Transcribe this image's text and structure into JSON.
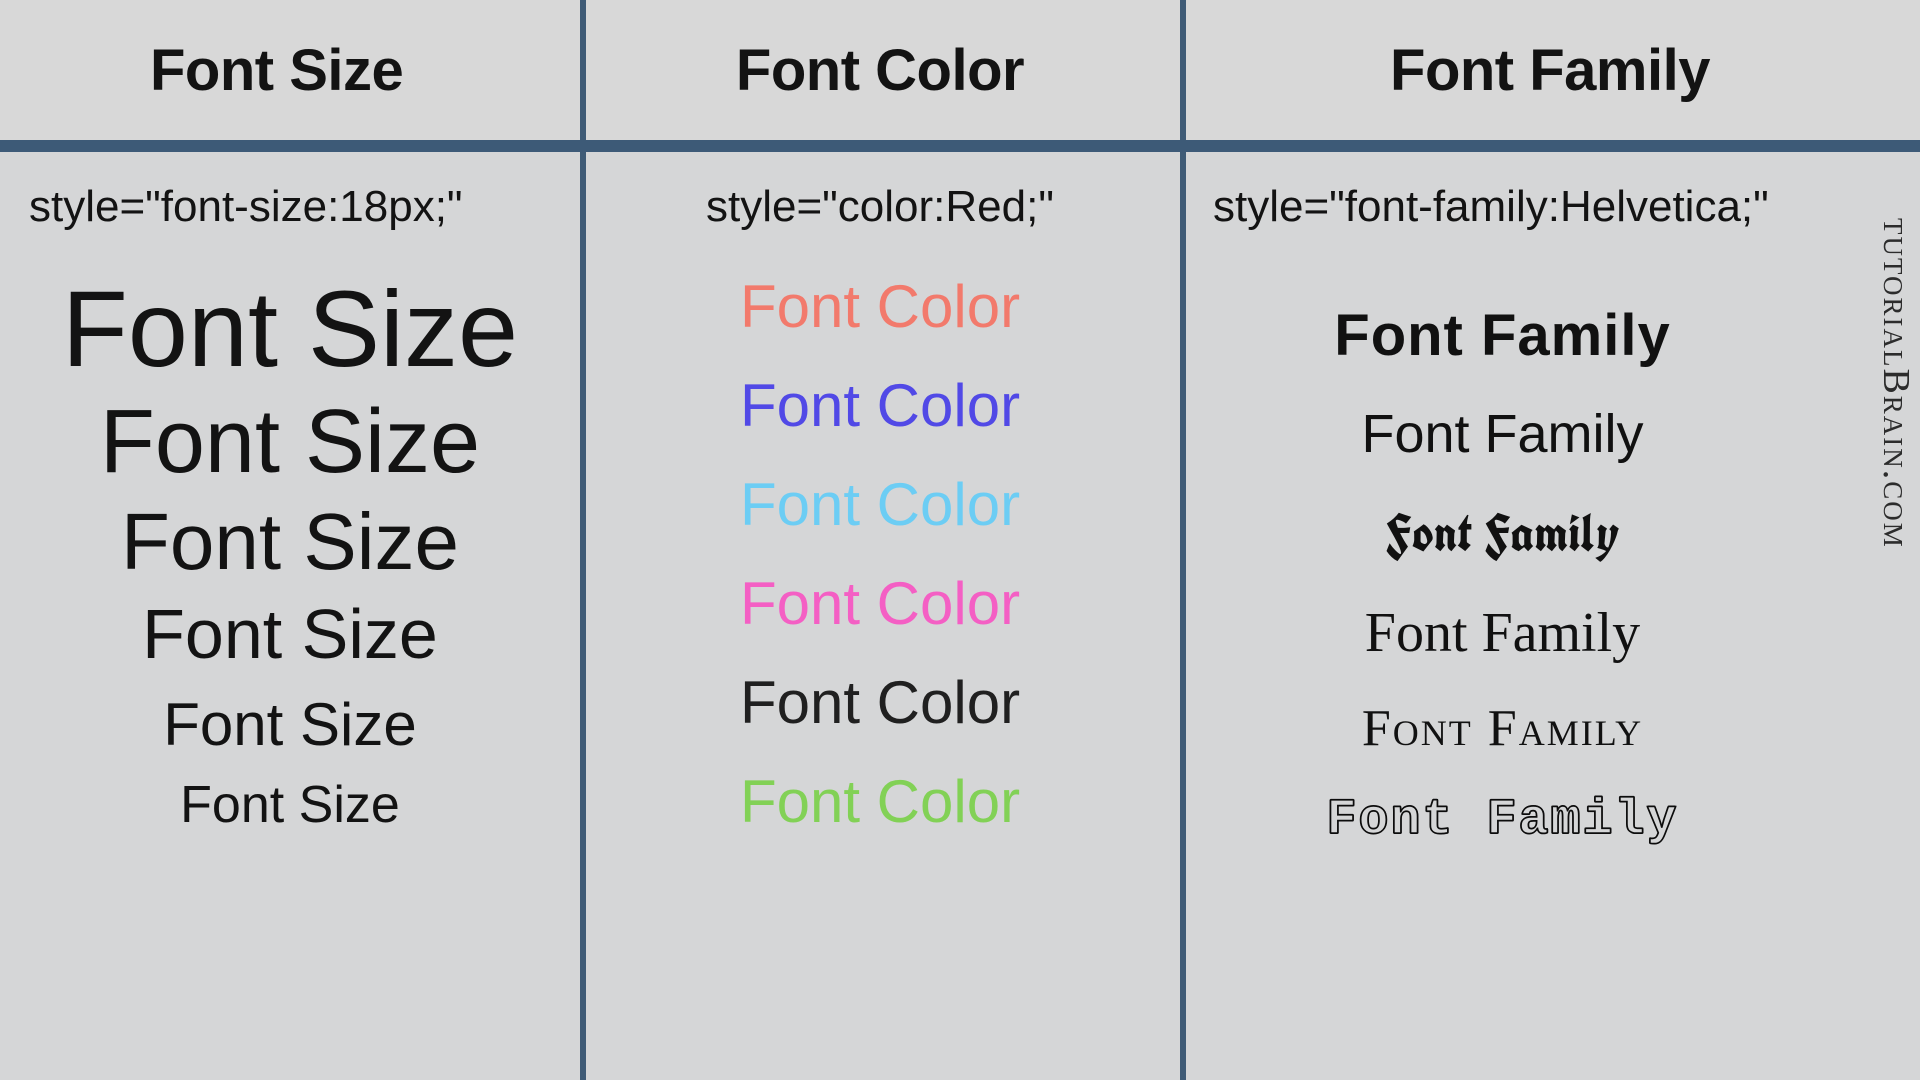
{
  "headers": {
    "size": "Font Size",
    "color": "Font Color",
    "family": "Font Family"
  },
  "syntax": {
    "size": "style=\"font-size:18px;\"",
    "color": "style=\"color:Red;\"",
    "family": "style=\"font-family:Helvetica;\""
  },
  "column_size": {
    "items": [
      {
        "label": "Font Size"
      },
      {
        "label": "Font Size"
      },
      {
        "label": "Font Size"
      },
      {
        "label": "Font Size"
      },
      {
        "label": "Font Size"
      },
      {
        "label": "Font Size"
      }
    ]
  },
  "column_color": {
    "items": [
      {
        "label": "Font Color",
        "color_name": "red",
        "hex": "#f27a6c"
      },
      {
        "label": "Font Color",
        "color_name": "blue",
        "hex": "#5149e6"
      },
      {
        "label": "Font Color",
        "color_name": "cyan",
        "hex": "#6ccdf4"
      },
      {
        "label": "Font Color",
        "color_name": "magenta",
        "hex": "#f45fc4"
      },
      {
        "label": "Font Color",
        "color_name": "black",
        "hex": "#202020"
      },
      {
        "label": "Font Color",
        "color_name": "green",
        "hex": "#82d156"
      }
    ]
  },
  "column_family": {
    "items": [
      {
        "label": "Font Family",
        "style": "display-heavy"
      },
      {
        "label": "Font Family",
        "style": "sans-serif"
      },
      {
        "label": "Font Family",
        "style": "blackletter"
      },
      {
        "label": "Font Family",
        "style": "serif"
      },
      {
        "label": "Font Family",
        "style": "small-caps-serif"
      },
      {
        "label": "Font Family",
        "style": "outline-mono"
      }
    ]
  },
  "watermark": "tutorialBrain.com"
}
